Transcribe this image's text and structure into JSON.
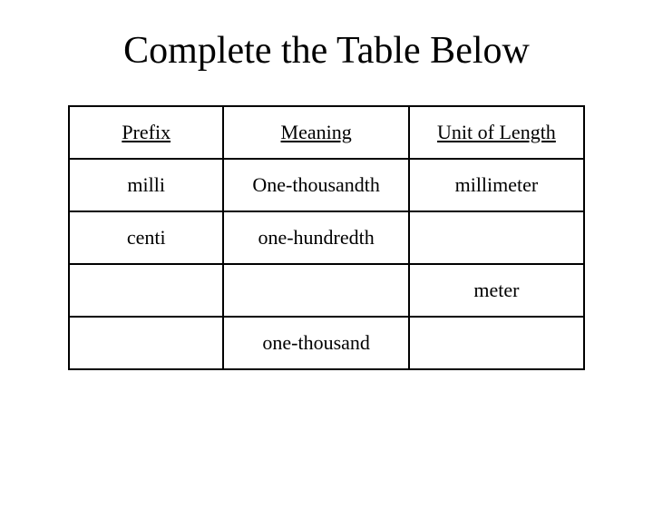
{
  "title": "Complete the Table Below",
  "headers": {
    "prefix": "Prefix",
    "meaning": "Meaning",
    "unit": "Unit of Length"
  },
  "rows": [
    {
      "prefix": "milli",
      "meaning": "One-thousandth",
      "unit": "millimeter"
    },
    {
      "prefix": "centi",
      "meaning": "one-hundredth",
      "unit": ""
    },
    {
      "prefix": "",
      "meaning": "",
      "unit": "meter"
    },
    {
      "prefix": "",
      "meaning": "one-thousand",
      "unit": ""
    }
  ],
  "chart_data": {
    "type": "table",
    "title": "Complete the Table Below",
    "columns": [
      "Prefix",
      "Meaning",
      "Unit of Length"
    ],
    "rows": [
      [
        "milli",
        "One-thousandth",
        "millimeter"
      ],
      [
        "centi",
        "one-hundredth",
        ""
      ],
      [
        "",
        "",
        "meter"
      ],
      [
        "",
        "one-thousand",
        ""
      ]
    ]
  }
}
